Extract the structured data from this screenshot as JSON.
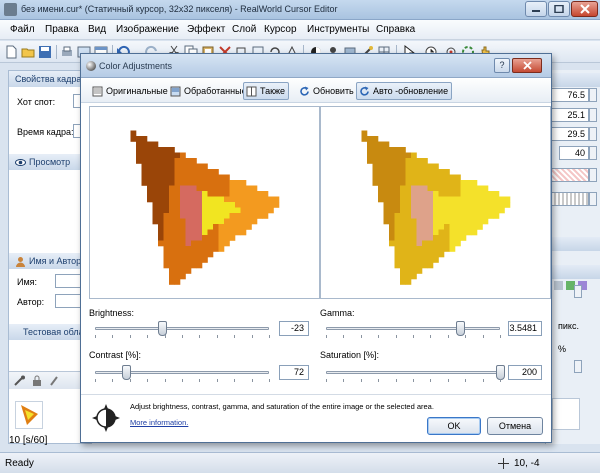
{
  "app": {
    "title": "без имени.cur* (Статичный курсор, 32x32 пикселя) - RealWorld Cursor Editor"
  },
  "menu": [
    "Файл",
    "Правка",
    "Вид",
    "Изображение",
    "Эффект",
    "Слой",
    "Курсор",
    "Инструменты",
    "Справка"
  ],
  "left_panel": {
    "properties_title": "Свойства кадра",
    "hotspot_label": "Хот спот:",
    "frame_time_label": "Время кадра:",
    "preview_title": "Просмотр",
    "author_section_title": "Имя и Автор",
    "name_label": "Имя:",
    "author_label": "Автор:",
    "test_area_title": "Тестовая област",
    "frame_caption": "10 [s/60]"
  },
  "right_panel": {
    "values": [
      "76.5",
      "25.1",
      "29.5",
      "40"
    ],
    "unit_pixels": "пикс.",
    "unit_percent": "%"
  },
  "status": {
    "ready": "Ready",
    "coords": "10, -4"
  },
  "dialog": {
    "title": "Color Adjustments",
    "help_button": "?",
    "tabs": {
      "original": "Оригинальные",
      "processed": "Обработанные",
      "also": "Также",
      "refresh": "Обновить",
      "auto_refresh": "Авто -обновление"
    },
    "brightness": {
      "label": "Brightness:",
      "value": "-23",
      "level": -23,
      "min": -100,
      "max": 100
    },
    "contrast": {
      "label": "Contrast [%]:",
      "value": "72",
      "level": 72,
      "min": 0,
      "max": 400
    },
    "gamma": {
      "label": "Gamma:",
      "value": "3.5481",
      "level": 0.77
    },
    "saturation": {
      "label": "Saturation [%]:",
      "value": "200",
      "level": 200,
      "min": 0,
      "max": 200
    },
    "help_text": "Adjust brightness, contrast, gamma, and saturation of the entire image or the selected area.",
    "more_info": "More information.",
    "ok": "OK",
    "cancel": "Отмена"
  },
  "colors": {
    "orig_dark": "#9a4508",
    "orig_mid": "#d8700f",
    "orig_orange": "#f39a1f",
    "orig_yellow": "#f1e521",
    "orig_pink": "#d56a60",
    "proc_dark": "#c88a10",
    "proc_mid": "#e0b418",
    "proc_yellow": "#f4e12a",
    "proc_pink": "#dea28a"
  }
}
